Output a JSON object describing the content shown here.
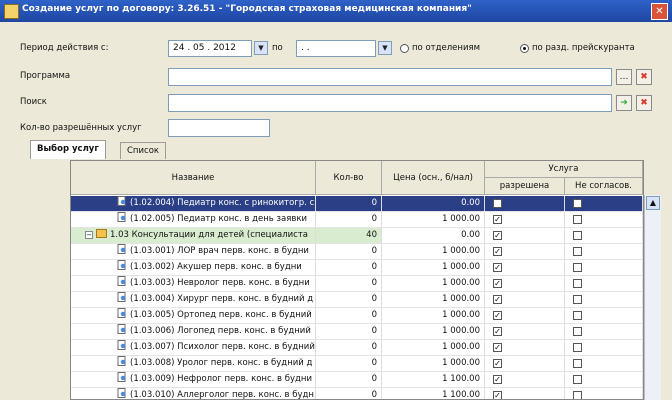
{
  "window": {
    "title": "Создание услуг по договору: 3.26.51 - \"Городская страховая медицинская компания\"",
    "close": "✕"
  },
  "form": {
    "period_label": "Период действия с:",
    "date_from": "24 . 05 . 2012",
    "po_label": "по",
    "date_to": " .   .  ",
    "radio_dept": "по отделениям",
    "radio_perm": "по разд. прейскуранта",
    "program_label": "Программа",
    "program_value": "",
    "search_label": "Поиск",
    "search_value": "",
    "count_label": "Кол-во разрешённых услуг",
    "count_value": ""
  },
  "tabs": [
    {
      "label": "Выбор услуг"
    },
    {
      "label": "Список"
    }
  ],
  "grid": {
    "headers": {
      "name": "Название",
      "qty": "Кол-во",
      "price": "Цена (осн., б/нал)",
      "service_group": "Услуга",
      "permitted": "разрешена",
      "not_agreed": "Не согласов."
    },
    "rows": [
      {
        "name": "(1.02.004) Педиатр конс. с ринокитогр. с",
        "qty": "0",
        "price": "0.00",
        "permitted": false,
        "not_agreed": false,
        "type": "doc",
        "selected": true
      },
      {
        "name": "(1.02.005) Педиатр конс. в день заявки",
        "qty": "0",
        "price": "1 000.00",
        "permitted": true,
        "not_agreed": false,
        "type": "doc"
      },
      {
        "name": "1.03 Консультации для детей (специалиста",
        "qty": "40",
        "price": "0.00",
        "permitted": true,
        "not_agreed": false,
        "type": "folder"
      },
      {
        "name": "(1.03.001) ЛОР врач перв. конс. в будни",
        "qty": "0",
        "price": "1 000.00",
        "permitted": true,
        "not_agreed": false,
        "type": "doc"
      },
      {
        "name": "(1.03.002) Акушер перв. конс. в будни",
        "qty": "0",
        "price": "1 000.00",
        "permitted": true,
        "not_agreed": false,
        "type": "doc"
      },
      {
        "name": "(1.03.003) Невролог перв. конс. в будни",
        "qty": "0",
        "price": "1 000.00",
        "permitted": true,
        "not_agreed": false,
        "type": "doc"
      },
      {
        "name": "(1.03.004) Хирург перв. конс. в будний д",
        "qty": "0",
        "price": "1 000.00",
        "permitted": true,
        "not_agreed": false,
        "type": "doc"
      },
      {
        "name": "(1.03.005) Ортопед перв. конс. в будний",
        "qty": "0",
        "price": "1 000.00",
        "permitted": true,
        "not_agreed": false,
        "type": "doc"
      },
      {
        "name": "(1.03.006) Логопед перв. конс. в будний",
        "qty": "0",
        "price": "1 000.00",
        "permitted": true,
        "not_agreed": false,
        "type": "doc"
      },
      {
        "name": "(1.03.007) Психолог перв. конс. в будний",
        "qty": "0",
        "price": "1 000.00",
        "permitted": true,
        "not_agreed": false,
        "type": "doc"
      },
      {
        "name": "(1.03.008) Уролог перв. конс. в будний д",
        "qty": "0",
        "price": "1 000.00",
        "permitted": true,
        "not_agreed": false,
        "type": "doc"
      },
      {
        "name": "(1.03.009) Нефролог перв. конс. в будни",
        "qty": "0",
        "price": "1 100.00",
        "permitted": true,
        "not_agreed": false,
        "type": "doc"
      },
      {
        "name": "(1.03.010) Аллерголог перв. конс. в будн",
        "qty": "0",
        "price": "1 100.00",
        "permitted": true,
        "not_agreed": false,
        "type": "doc"
      }
    ]
  },
  "buttons": {
    "ellipsis": "…",
    "clear": "✖",
    "go": "➜",
    "dropdown": "▼",
    "scroll_up": "▲"
  },
  "colors": {
    "title_bar": "#2552b3",
    "selection": "#2a3f85",
    "folder_row": "#d9eccf",
    "clear_icon": "#d83a2a",
    "go_icon": "#3aa53a"
  }
}
